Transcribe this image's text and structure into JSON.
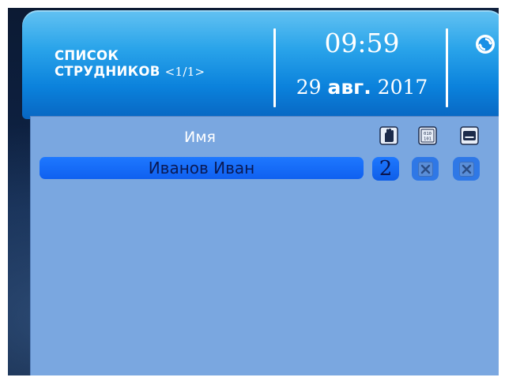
{
  "header": {
    "title_line1": "СПИСОК",
    "title_line2": "СТРУДНИКОВ",
    "page_indicator": "<1/1>",
    "time": "09:59",
    "date_day": "29",
    "date_month": "авг.",
    "date_year": "2017",
    "refresh_icon": "refresh-icon"
  },
  "table": {
    "column_name": "Имя",
    "header_icons": [
      "hand-icon",
      "binary-code-icon",
      "card-icon"
    ],
    "rows": [
      {
        "name": "Иванов Иван",
        "count": "2"
      }
    ]
  },
  "colors": {
    "header_top": "#63c2f2",
    "header_bottom": "#0866c2",
    "panel": "#7aa7e0",
    "row_highlight": "#1e78ff"
  }
}
